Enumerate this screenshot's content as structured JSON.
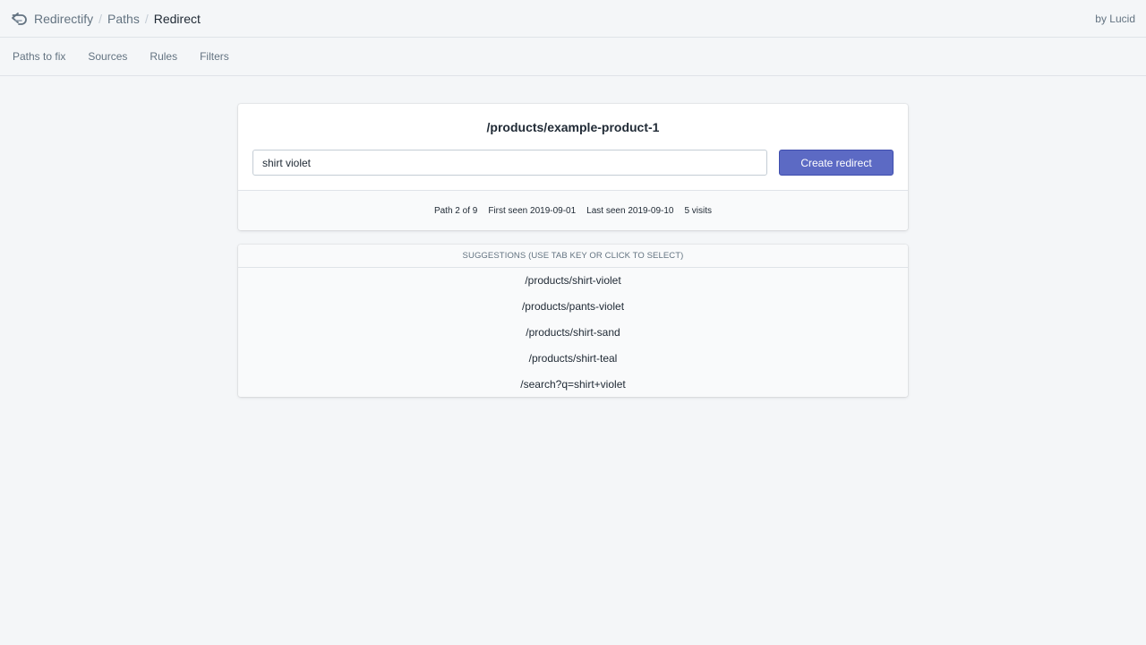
{
  "app": {
    "name": "Redirectify",
    "byline": "by Lucid"
  },
  "breadcrumb": {
    "items": [
      "Redirectify",
      "Paths"
    ],
    "current": "Redirect",
    "separator": "/"
  },
  "subnav": {
    "items": [
      "Paths to fix",
      "Sources",
      "Rules",
      "Filters"
    ]
  },
  "redirect_card": {
    "path": "/products/example-product-1",
    "input_value": "shirt violet",
    "button_label": "Create redirect",
    "meta": {
      "position": "Path 2 of 9",
      "first_seen": "First seen 2019-09-01",
      "last_seen": "Last seen 2019-09-10",
      "visits": "5 visits"
    }
  },
  "suggestions": {
    "header": "Suggestions (use tab key or click to select)",
    "items": [
      "/products/shirt-violet",
      "/products/pants-violet",
      "/products/shirt-sand",
      "/products/shirt-teal",
      "/search?q=shirt+violet"
    ]
  },
  "colors": {
    "primary": "#5c6ac4",
    "background": "#f4f6f8",
    "text": "#212b36",
    "muted": "#637381"
  },
  "icons": {
    "logo": "redirect-arrow-icon"
  }
}
